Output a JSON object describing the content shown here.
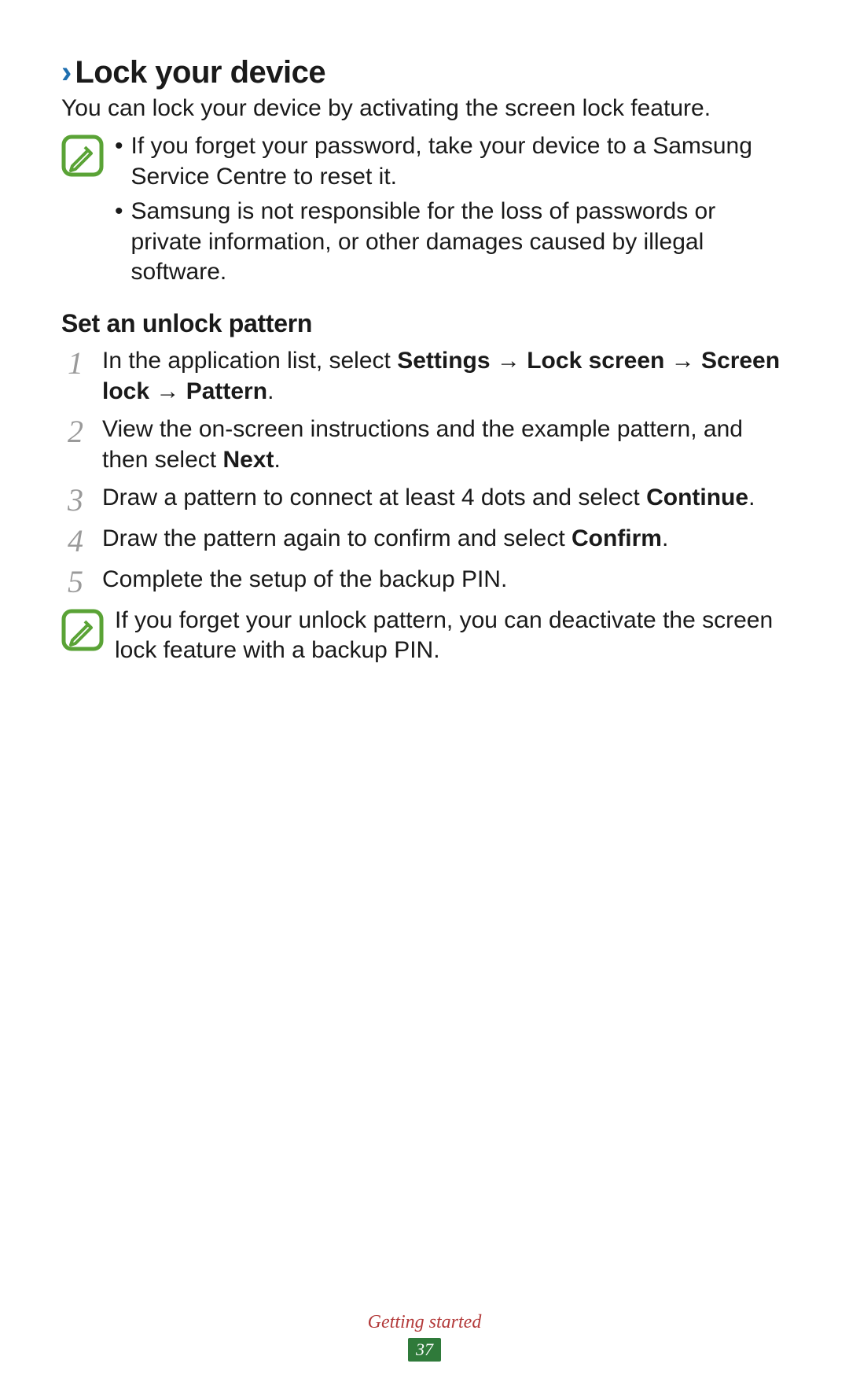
{
  "heading": {
    "chevron": "›",
    "title": "Lock your device"
  },
  "intro": "You can lock your device by activating the screen lock feature.",
  "note1": {
    "bullets": [
      "If you forget your password, take your device to a Samsung Service Centre to reset it.",
      "Samsung is not responsible for the loss of passwords or private information, or other damages caused by illegal software."
    ]
  },
  "subheading": "Set an unlock pattern",
  "steps": [
    {
      "num": "1",
      "pre": "In the application list, select ",
      "bold": "Settings → Lock screen → Screen lock → Pattern",
      "post": "."
    },
    {
      "num": "2",
      "pre": "View the on-screen instructions and the example pattern, and then select ",
      "bold": "Next",
      "post": "."
    },
    {
      "num": "3",
      "pre": "Draw a pattern to connect at least 4 dots and select ",
      "bold": "Continue",
      "post": "."
    },
    {
      "num": "4",
      "pre": "Draw the pattern again to confirm and select ",
      "bold": "Confirm",
      "post": "."
    },
    {
      "num": "5",
      "pre": "Complete the setup of the backup PIN.",
      "bold": "",
      "post": ""
    }
  ],
  "note2": "If you forget your unlock pattern, you can deactivate the screen lock feature with a backup PIN.",
  "footer": {
    "section": "Getting started",
    "page": "37"
  }
}
